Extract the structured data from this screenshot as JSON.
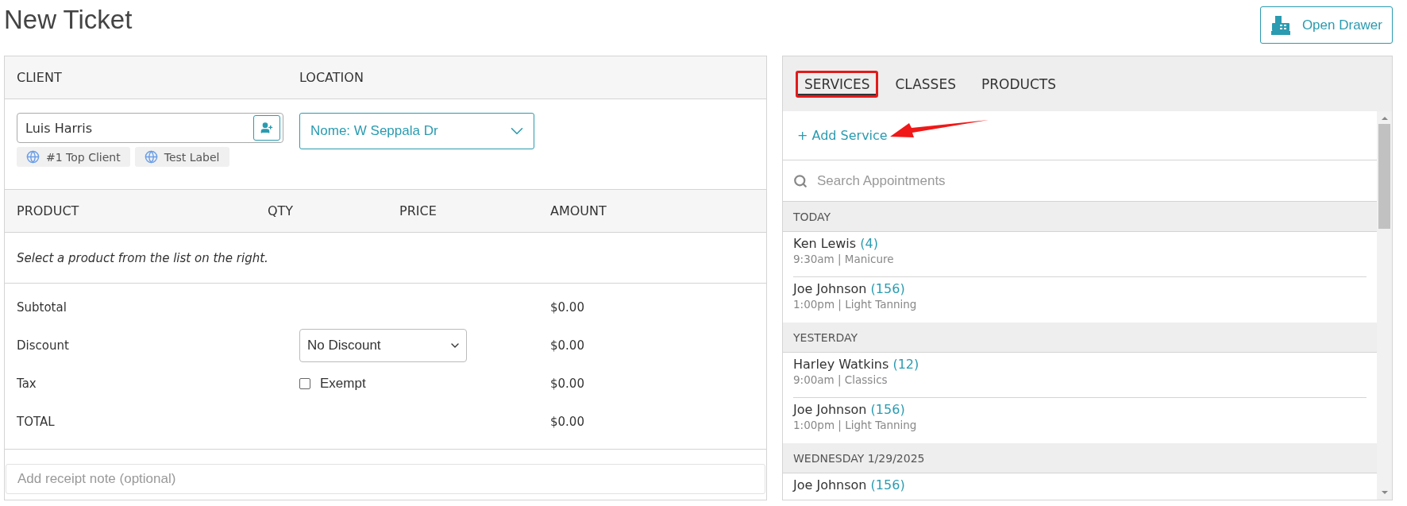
{
  "title": "New Ticket",
  "open_drawer": {
    "label": "Open Drawer"
  },
  "ticket": {
    "client_header": "CLIENT",
    "location_header": "LOCATION",
    "client": {
      "value": "Luis Harris"
    },
    "client_labels": [
      "#1 Top Client",
      "Test Label"
    ],
    "location": {
      "value": "Nome: W Seppala Dr"
    },
    "columns": [
      "PRODUCT",
      "QTY",
      "PRICE",
      "AMOUNT"
    ],
    "empty_message": "Select a product from the list on the right.",
    "totals": [
      {
        "kind": "plain",
        "label": "Subtotal",
        "amount": "$0.00"
      },
      {
        "kind": "select",
        "label": "Discount",
        "value": "No Discount",
        "amount": "$0.00"
      },
      {
        "kind": "checkbox",
        "label": "Tax",
        "option": "Exempt",
        "checked": false,
        "amount": "$0.00"
      },
      {
        "kind": "plain",
        "label": "TOTAL",
        "amount": "$0.00"
      }
    ],
    "note": {
      "placeholder": "Add receipt note (optional)"
    }
  },
  "catalog": {
    "tabs": [
      {
        "label": "SERVICES",
        "selected": true,
        "highlighted": true
      },
      {
        "label": "CLASSES",
        "selected": false,
        "highlighted": false
      },
      {
        "label": "PRODUCTS",
        "selected": false,
        "highlighted": false
      }
    ],
    "add_link": {
      "label": "+ Add Service",
      "annotated": true
    },
    "search": {
      "placeholder": "Search Appointments"
    },
    "groups": [
      {
        "heading": "TODAY",
        "items": [
          {
            "name": "Ken Lewis",
            "count": "(4)",
            "detail": "9:30am | Manicure"
          },
          {
            "name": "Joe Johnson",
            "count": "(156)",
            "detail": "1:00pm | Light Tanning"
          }
        ]
      },
      {
        "heading": "YESTERDAY",
        "items": [
          {
            "name": "Harley Watkins",
            "count": "(12)",
            "detail": "9:00am | Classics"
          },
          {
            "name": "Joe Johnson",
            "count": "(156)",
            "detail": "1:00pm | Light Tanning"
          }
        ]
      },
      {
        "heading": "WEDNESDAY 1/29/2025",
        "items": [
          {
            "name": "Joe Johnson",
            "count": "(156)"
          }
        ]
      }
    ]
  }
}
